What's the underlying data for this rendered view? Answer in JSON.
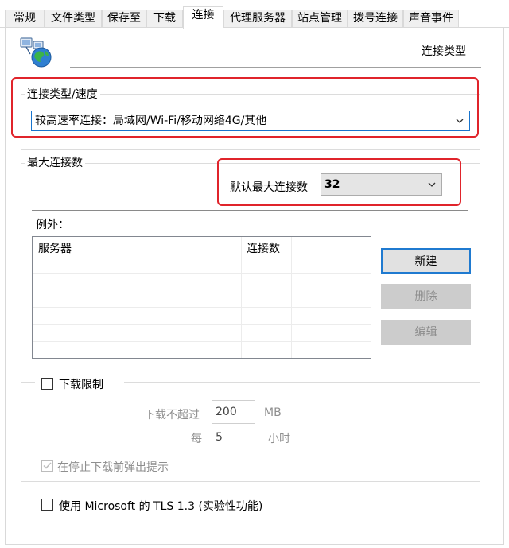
{
  "tabs": [
    "常规",
    "文件类型",
    "保存至",
    "下载",
    "连接",
    "代理服务器",
    "站点管理",
    "拨号连接",
    "声音事件"
  ],
  "active_tab": "连接",
  "header": {
    "title": "连接类型"
  },
  "connection_group": {
    "title": "连接类型/速度",
    "selected_value": "较高速率连接：局域网/Wi-Fi/移动网络4G/其他"
  },
  "max_conn_group": {
    "title": "最大连接数",
    "default_label": "默认最大连接数",
    "default_value": "32",
    "exceptions_label": "例外：",
    "columns": [
      "服务器",
      "连接数"
    ],
    "buttons": {
      "new": "新建",
      "delete": "删除",
      "edit": "编辑"
    }
  },
  "download_limit": {
    "checkbox_label": "下载限制",
    "max_label": "下载不超过",
    "max_value": "200",
    "max_unit": "MB",
    "per_label": "每",
    "per_value": "5",
    "per_unit": "小时",
    "notify_label": "在停止下载前弹出提示"
  },
  "tls": {
    "label": "使用 Microsoft 的 TLS 1.3 (实验性功能)"
  },
  "colors": {
    "highlight_red": "#e0242b",
    "focus_blue": "#1f7ad0"
  }
}
